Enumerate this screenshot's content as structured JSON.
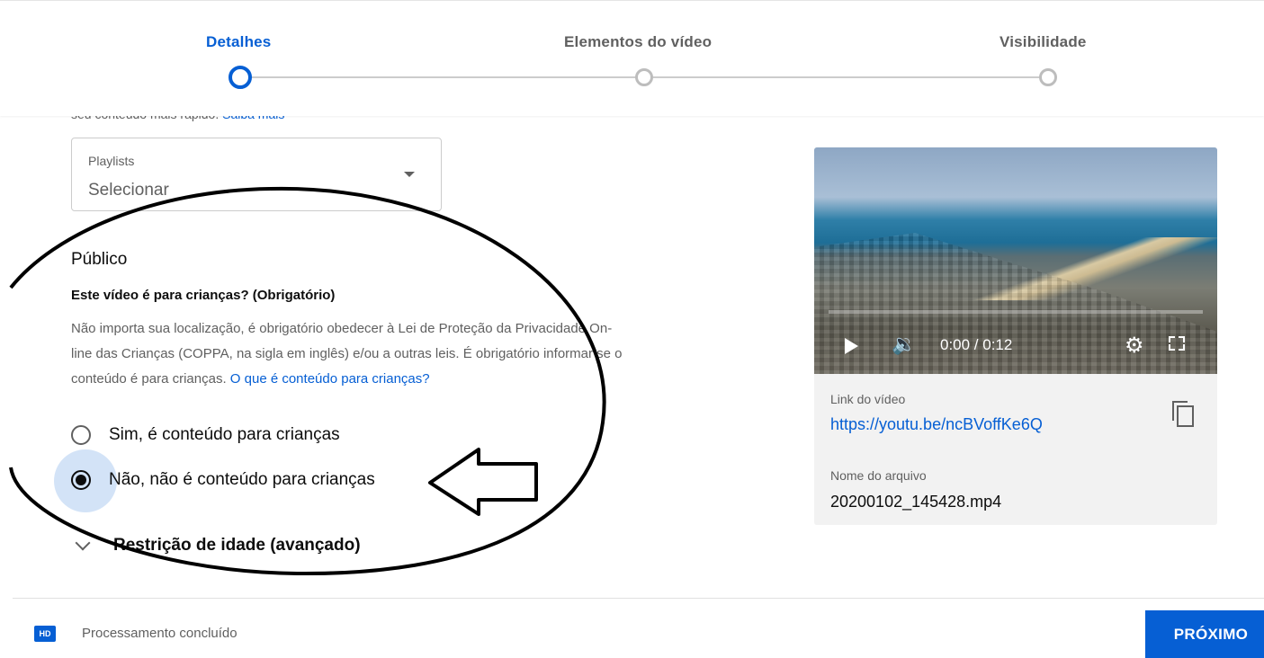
{
  "stepper": {
    "steps": [
      {
        "label": "Detalhes",
        "state": "active"
      },
      {
        "label": "Elementos do vídeo",
        "state": "inactive"
      },
      {
        "label": "Visibilidade",
        "state": "inactive"
      }
    ]
  },
  "partial_text": {
    "text": "seu conteúdo mais rápido.",
    "link": "Saiba mais"
  },
  "playlists": {
    "label": "Playlists",
    "value": "Selecionar"
  },
  "audience": {
    "title": "Público",
    "question": "Este vídeo é para crianças? (Obrigatório)",
    "description_lines": [
      "Não importa sua localização, é obrigatório obedecer à Lei de Proteção da Privacidade On-",
      "line das Crianças (COPPA, na sigla em inglês) e/ou a outras leis. É obrigatório informar se o",
      "conteúdo é para crianças."
    ],
    "help_link": "O que é conteúdo para crianças?",
    "options": [
      {
        "label": "Sim, é conteúdo para crianças",
        "checked": false
      },
      {
        "label": "Não, não é conteúdo para crianças",
        "checked": true
      }
    ],
    "advanced_label": "Restrição de idade (avançado)"
  },
  "video": {
    "time": "0:00 / 0:12",
    "progress_fraction": 0.0,
    "link_label": "Link do vídeo",
    "link": "https://youtu.be/ncBVoffKe6Q",
    "filename_label": "Nome do arquivo",
    "filename": "20200102_145428.mp4"
  },
  "footer": {
    "hd_badge": "HD",
    "status": "Processamento concluído",
    "next_label": "PRÓXIMO"
  },
  "colors": {
    "accent": "#065fd4",
    "annotation": "#000000"
  }
}
